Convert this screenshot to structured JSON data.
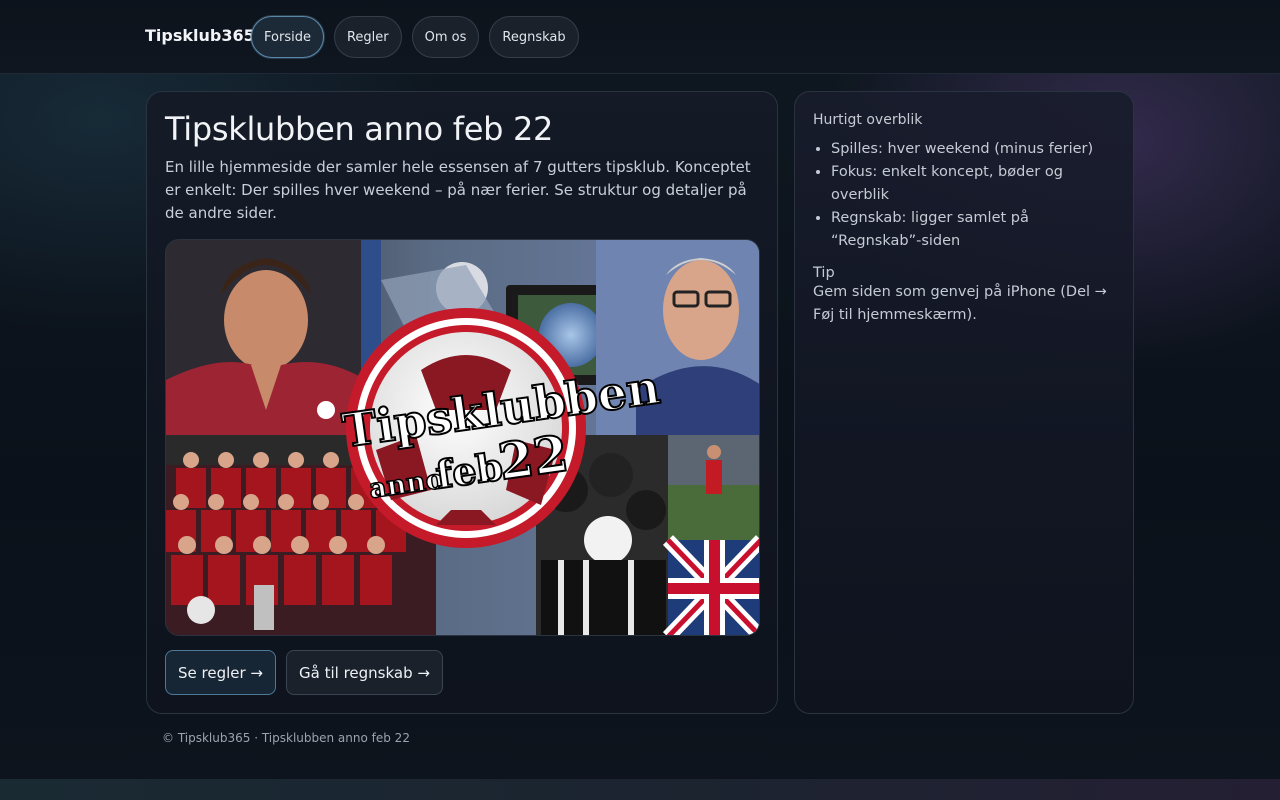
{
  "header": {
    "brand": "Tipsklub365",
    "nav": [
      {
        "label": "Forside",
        "active": true
      },
      {
        "label": "Regler",
        "active": false
      },
      {
        "label": "Om os",
        "active": false
      },
      {
        "label": "Regnskab",
        "active": false
      }
    ]
  },
  "main": {
    "title": "Tipsklubben anno feb 22",
    "intro": "En lille hjemmeside der samler hele essensen af 7 gutters tipsklub. Konceptet er enkelt: Der spilles hver weekend – på nær ferier. Se struktur og detaljer på de andre sider.",
    "hero": {
      "line1": "Tipsklubben",
      "line2a": "anno",
      "line2b": "feb",
      "line2c": "22"
    },
    "actions": {
      "rules": "Se regler →",
      "accounts": "Gå til regnskab →"
    }
  },
  "sidebar": {
    "title": "Hurtigt overblik",
    "items": [
      "Spilles: hver weekend (minus ferier)",
      "Fokus: enkelt koncept, bøder og overblik",
      "Regnskab: ligger samlet på “Regnskab”-siden"
    ],
    "tip_title": "Tip",
    "tip_text": "Gem siden som genvej på iPhone (Del → Føj til hjemmeskærm)."
  },
  "footer": {
    "text": "© Tipsklub365 · Tipsklubben anno feb 22"
  },
  "colors": {
    "accent": "#5a87a8",
    "background": "#0b111a",
    "card_border": "#2a3340",
    "liverpool_red": "#a4151d"
  }
}
